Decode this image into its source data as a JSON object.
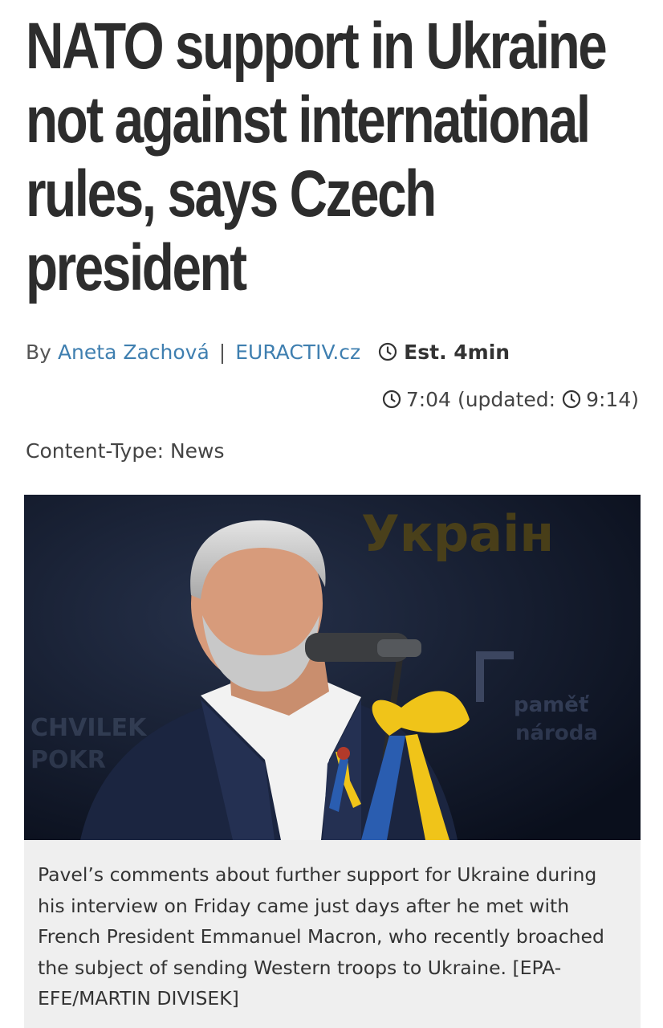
{
  "article": {
    "headline": "NATO support in Ukraine not against international rules, says Czech president",
    "byline": {
      "by": "By",
      "author": "Aneta Zachová",
      "separator": "|",
      "source": "EURACTIV.cz",
      "read_time": "Est. 4min"
    },
    "published": {
      "time": "7:04",
      "updated_label": "(updated:",
      "updated_time": "9:14)"
    },
    "content_type": "Content-Type: News",
    "image": {
      "background_text_1": "Украін",
      "background_text_2": "CHVILEK",
      "background_text_3": "POKR",
      "background_text_4": "paměť",
      "background_text_5": "národa"
    },
    "caption": "Pavel’s comments about further support for Ukraine during his interview on Friday came just days after he met with French President Emmanuel Macron, who recently broached the subject of sending Western troops to Ukraine. [EPA-EFE/MARTIN DIVISEK]"
  },
  "colors": {
    "link": "#3f7fb0",
    "headline": "#2d2d2d",
    "caption_bg": "#efefef"
  },
  "icons": [
    "clock-icon"
  ]
}
